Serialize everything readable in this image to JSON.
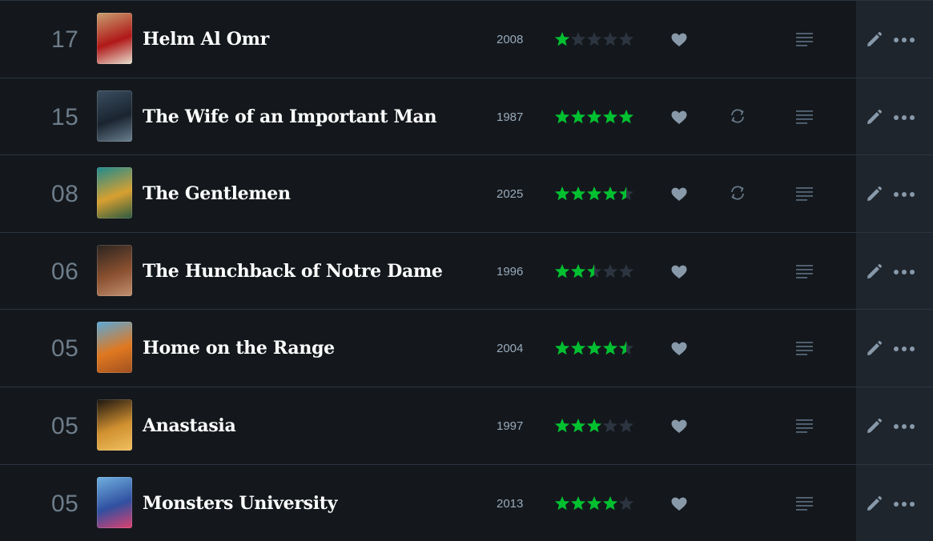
{
  "colors": {
    "background": "#14181c",
    "actions_column": "#1e252c",
    "divider": "#2c3440",
    "star_filled": "#00c030",
    "star_empty": "#2c3440",
    "icon_gray": "#678",
    "day_text": "#6e7d8b",
    "year_text": "#99aabb",
    "title_text": "#ffffff"
  },
  "entries": [
    {
      "day": "17",
      "title": "Helm Al Omr",
      "year": "2008",
      "rating": 1,
      "liked": true,
      "rewatch": false,
      "review_icon": "review-lines-icon",
      "poster_colors": [
        "#c8a070",
        "#b01818",
        "#e8e0d0"
      ]
    },
    {
      "day": "15",
      "title": "The Wife of an Important Man",
      "year": "1987",
      "rating": 5,
      "liked": true,
      "rewatch": true,
      "review_icon": "review-lines-icon",
      "poster_colors": [
        "#3a4e60",
        "#1a2430",
        "#6a8090"
      ]
    },
    {
      "day": "08",
      "title": "The Gentlemen",
      "year": "2025",
      "rating": 4.5,
      "liked": true,
      "rewatch": true,
      "review_icon": "review-lines-icon",
      "poster_colors": [
        "#1e8a90",
        "#d8a030",
        "#2a5a40"
      ]
    },
    {
      "day": "06",
      "title": "The Hunchback of Notre Dame",
      "year": "1996",
      "rating": 2.5,
      "liked": true,
      "rewatch": false,
      "review_icon": "review-lines-icon",
      "poster_colors": [
        "#2a2420",
        "#8a5030",
        "#c09070"
      ]
    },
    {
      "day": "05",
      "title": "Home on the Range",
      "year": "2004",
      "rating": 4.5,
      "liked": true,
      "rewatch": false,
      "review_icon": "review-lines-icon",
      "poster_colors": [
        "#5aa8d8",
        "#e07820",
        "#a05020"
      ]
    },
    {
      "day": "05",
      "title": "Anastasia",
      "year": "1997",
      "rating": 3,
      "liked": true,
      "rewatch": false,
      "review_icon": "review-lines-icon",
      "poster_colors": [
        "#1a1410",
        "#d09030",
        "#f0c060"
      ]
    },
    {
      "day": "05",
      "title": "Monsters University",
      "year": "2013",
      "rating": 4,
      "liked": true,
      "rewatch": false,
      "review_icon": "review-lines-icon",
      "poster_colors": [
        "#70b0e0",
        "#3050a0",
        "#e04070"
      ]
    }
  ]
}
